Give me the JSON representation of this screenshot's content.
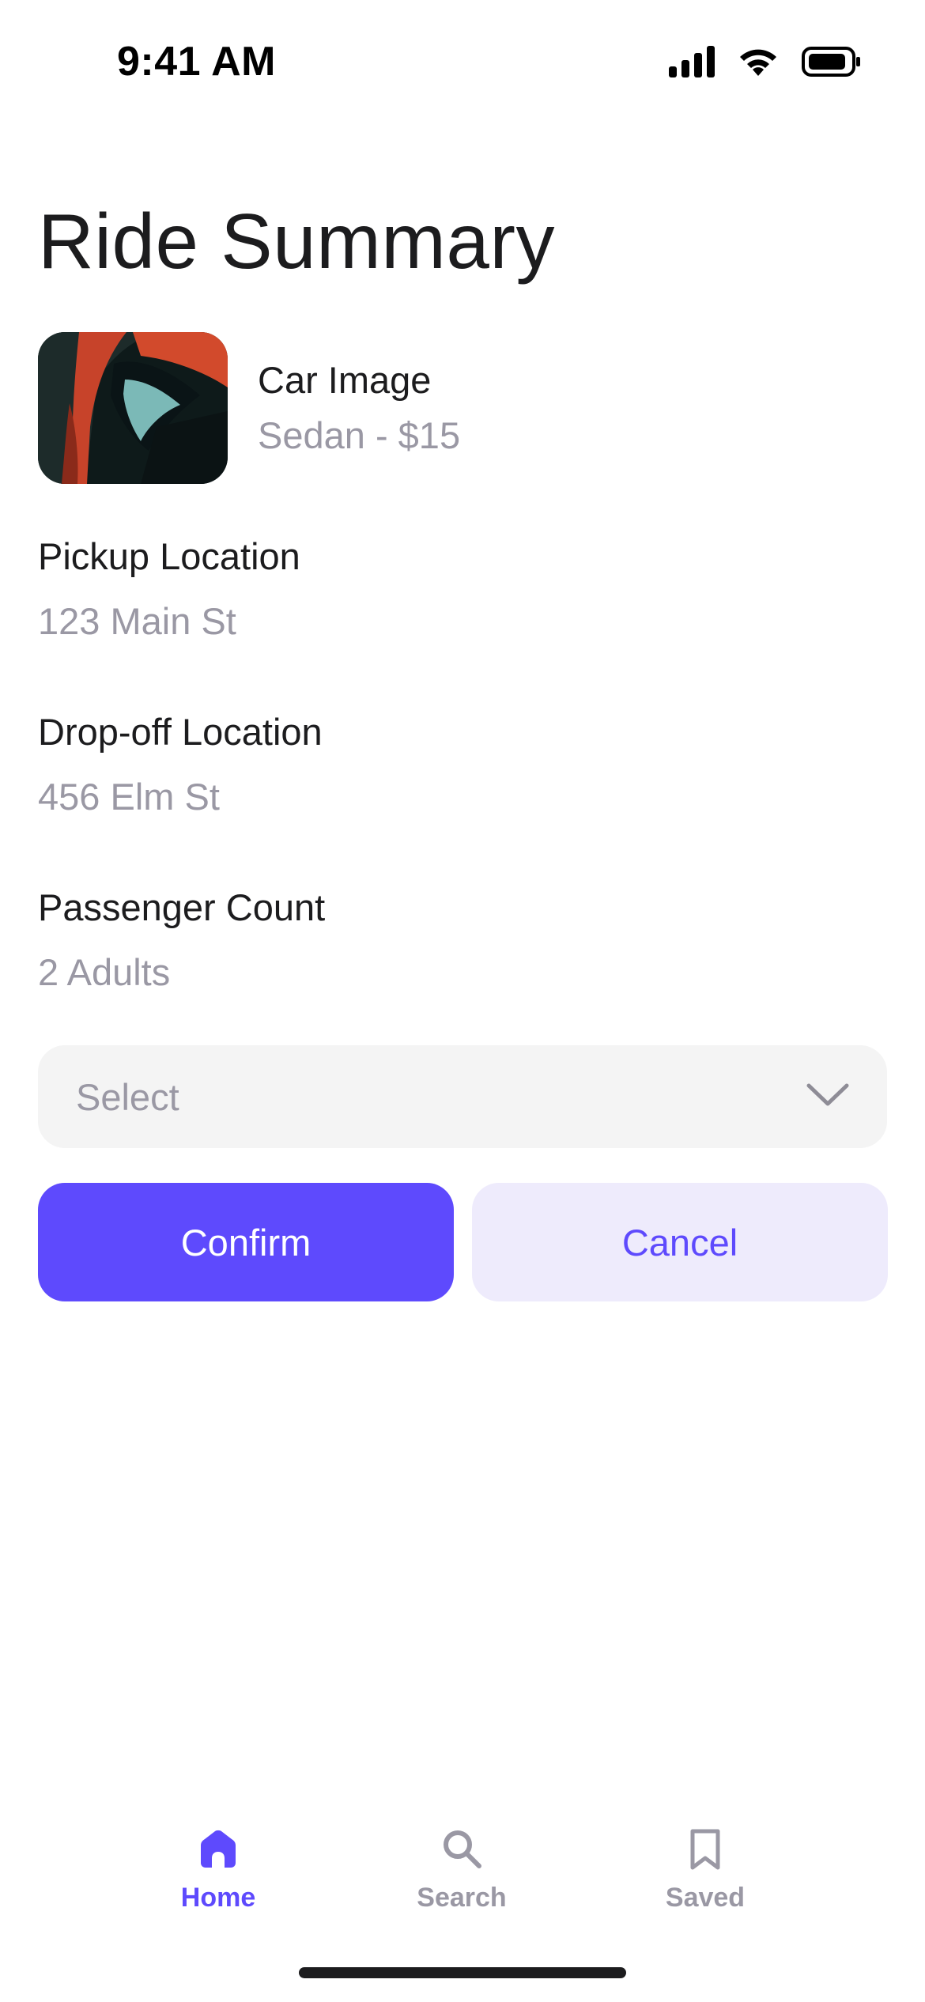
{
  "status_bar": {
    "time": "9:41 AM",
    "icons": [
      "cellular-signal-icon",
      "wifi-icon",
      "battery-icon"
    ]
  },
  "page": {
    "title": "Ride Summary"
  },
  "car": {
    "name": "Car Image",
    "subtitle": "Sedan - $15"
  },
  "details": {
    "pickup": {
      "label": "Pickup Location",
      "value": "123 Main St"
    },
    "dropoff": {
      "label": "Drop-off Location",
      "value": "456 Elm St"
    },
    "passengers": {
      "label": "Passenger Count",
      "value": "2 Adults"
    }
  },
  "select": {
    "value": "Select",
    "icon": "chevron-down-icon"
  },
  "actions": {
    "confirm_label": "Confirm",
    "cancel_label": "Cancel"
  },
  "tab_bar": {
    "items": [
      {
        "label": "Home",
        "icon": "home-icon",
        "active": true
      },
      {
        "label": "Search",
        "icon": "search-icon",
        "active": false
      },
      {
        "label": "Saved",
        "icon": "bookmark-icon",
        "active": false
      }
    ]
  },
  "colors": {
    "accent": "#5e4afd",
    "accent_soft": "#eeebfc",
    "muted_text": "#9a98a4",
    "field_bg": "#f4f4f4"
  }
}
